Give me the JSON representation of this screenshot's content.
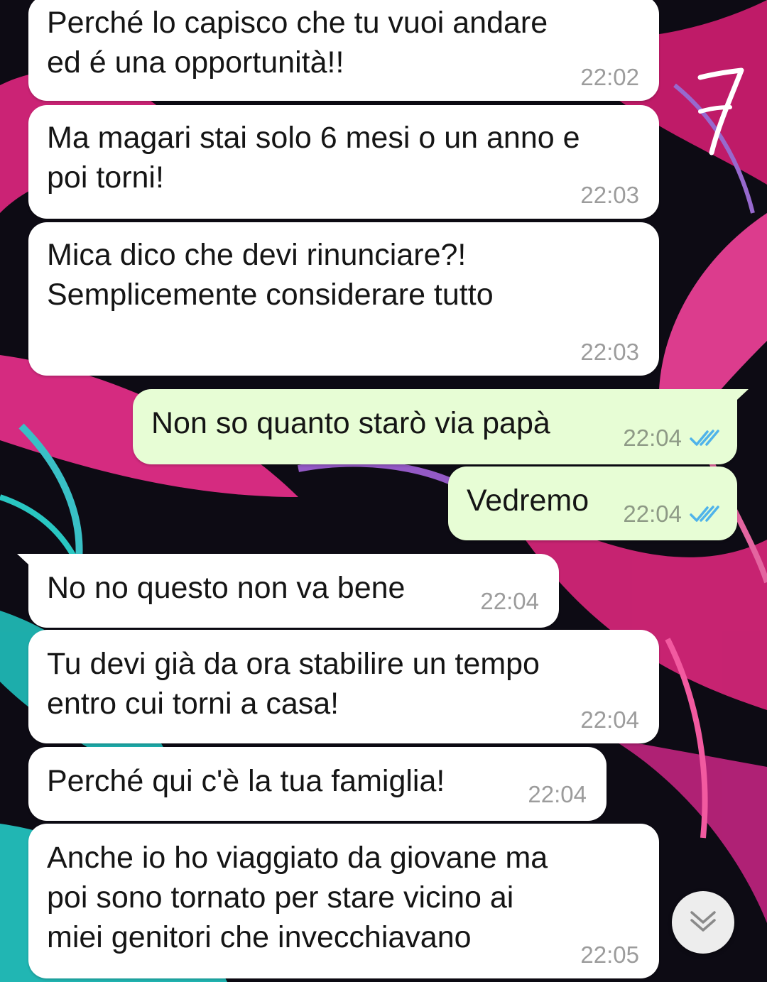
{
  "messages": [
    {
      "direction": "incoming",
      "text": "Perché lo capisco che tu vuoi andare\ned é una opportunità!!",
      "time": "22:02"
    },
    {
      "direction": "incoming",
      "text": "Ma magari stai solo 6 mesi o un anno e\npoi torni!",
      "time": "22:03"
    },
    {
      "direction": "incoming",
      "text": "Mica dico che devi rinunciare?!\nSemplicemente considerare tutto",
      "time": "22:03"
    },
    {
      "direction": "outgoing",
      "text": "Non so quanto starò via papà",
      "time": "22:04",
      "status": "read"
    },
    {
      "direction": "outgoing",
      "text": "Vedremo",
      "time": "22:04",
      "status": "read"
    },
    {
      "direction": "incoming",
      "text": "No no questo non va bene",
      "time": "22:04"
    },
    {
      "direction": "incoming",
      "text": "Tu devi già da ora stabilire un tempo\nentro cui torni a casa!",
      "time": "22:04"
    },
    {
      "direction": "incoming",
      "text": "Perché qui c'è la tua famiglia!",
      "time": "22:04"
    },
    {
      "direction": "incoming",
      "text": "Anche io ho viaggiato da giovane ma\npoi sono tornato per stare vicino ai\nmiei genitori che invecchiavano",
      "time": "22:05"
    }
  ],
  "annotation": {
    "page_number": "7"
  },
  "icons": {
    "read_receipt": "double-check-icon",
    "scroll_down": "chevron-double-down-icon"
  },
  "colors": {
    "incoming_bubble": "#ffffff",
    "outgoing_bubble": "#e7fdd5",
    "read_tick": "#4fb3ea",
    "timestamp": "#9c9c9c"
  }
}
